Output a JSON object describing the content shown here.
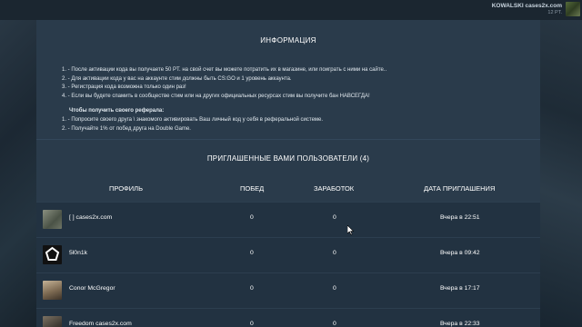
{
  "user": {
    "name": "KOWALSKI cases2x.com",
    "points": "12 PT."
  },
  "info": {
    "title": "ИНФОРМАЦИЯ",
    "rules": [
      "1. - После активации кода вы получаете 50 PT. на свой счет вы можете потратить их в магазине, или поиграть с ними на сайте..",
      "2. - Для активации кода у вас на аккаунте стим должны быть CS:GO и 1 уровень аккаунта.",
      "3. - Регистрация кода возможна только один раз!",
      "4. - Если вы будете спамить в сообществе стим или на других официальных ресурсах стим вы получите бан НАВСЕГДА!"
    ],
    "referral_title": "Чтобы получить своего реферала:",
    "referral_steps": [
      "1. - Попросите своего друга \\ знакомого активировать Ваш личный код у себя в реферальной системе.",
      "2. - Получайте 1% от побед друга на Double Game."
    ]
  },
  "invited": {
    "title": "ПРИГЛАШЕННЫЕ ВАМИ ПОЛЬЗОВАТЕЛИ (4)",
    "columns": [
      "ПРОФИЛЬ",
      "ПОБЕД",
      "ЗАРАБОТОК",
      "ДАТА ПРИГЛАШЕНИЯ"
    ],
    "rows": [
      {
        "name": "[ ] cases2x.com",
        "wins": "0",
        "earnings": "0",
        "date": "Вчера в 22:51",
        "avatar_color": "#6e7566"
      },
      {
        "name": "5l0n1k",
        "wins": "0",
        "earnings": "0",
        "date": "Вчера в 09:42",
        "avatar_color": "#ffffff"
      },
      {
        "name": "Conor McGregor",
        "wins": "0",
        "earnings": "0",
        "date": "Вчера в 17:17",
        "avatar_color": "#9a8468"
      },
      {
        "name": "Freedom cases2x.com",
        "wins": "0",
        "earnings": "0",
        "date": "Вчера в 22:33",
        "avatar_color": "#5b5348"
      }
    ]
  }
}
